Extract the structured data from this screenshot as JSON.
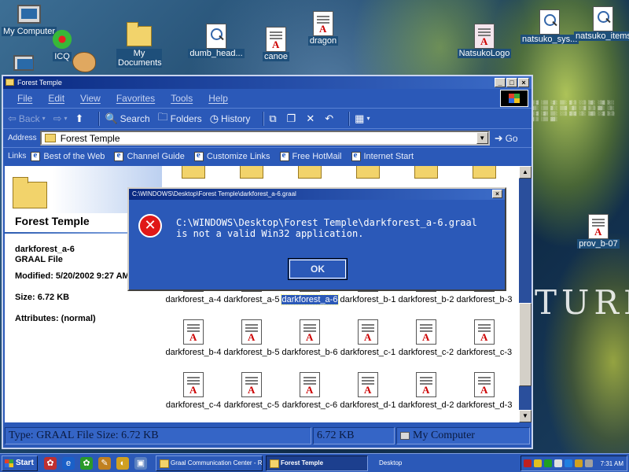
{
  "desktop": {
    "icons": [
      {
        "label": "My Computer"
      },
      {
        "label": "ICQ"
      },
      {
        "label": "My Documents"
      },
      {
        "label": "dumb_head..."
      },
      {
        "label": "canoe"
      },
      {
        "label": "dragon"
      },
      {
        "label": "NatsukoLogo"
      },
      {
        "label": "natsuko_sys..."
      },
      {
        "label": "natsuko_items"
      },
      {
        "label": "prov_b-07"
      }
    ],
    "wallpaper_text": "TURE"
  },
  "window": {
    "title": "Forest Temple",
    "menu": [
      "File",
      "Edit",
      "View",
      "Favorites",
      "Tools",
      "Help"
    ],
    "toolbar": {
      "back": "Back",
      "search": "Search",
      "folders": "Folders",
      "history": "History"
    },
    "address": {
      "label": "Address",
      "value": "Forest Temple",
      "go": "Go"
    },
    "links": {
      "label": "Links",
      "items": [
        "Best of the Web",
        "Channel Guide",
        "Customize Links",
        "Free HotMail",
        "Internet Start"
      ]
    },
    "left_pane": {
      "folder_title": "Forest Temple",
      "file_name": "darkforest_a-6",
      "file_type": "GRAAL File",
      "modified": "Modified: 5/20/2002 9:27 AM",
      "size": "Size: 6.72 KB",
      "attributes": "Attributes: (normal)"
    },
    "files": [
      "darkforest_a-4",
      "darkforest_a-5",
      "darkforest_a-6",
      "darkforest_b-1",
      "darkforest_b-2",
      "darkforest_b-3",
      "darkforest_b-4",
      "darkforest_b-5",
      "darkforest_b-6",
      "darkforest_c-1",
      "darkforest_c-2",
      "darkforest_c-3",
      "darkforest_c-4",
      "darkforest_c-5",
      "darkforest_c-6",
      "darkforest_d-1",
      "darkforest_d-2",
      "darkforest_d-3"
    ],
    "selected_file": "darkforest_a-6",
    "statusbar": {
      "info": "Type: GRAAL File Size: 6.72 KB",
      "size": "6.72 KB",
      "zone": "My Computer"
    }
  },
  "dialog": {
    "title": "C:\\WINDOWS\\Desktop\\Forest Temple\\darkforest_a-6.graal",
    "message": "C:\\WINDOWS\\Desktop\\Forest Temple\\darkforest_a-6.graal is not a valid Win32 application.",
    "ok_label": "OK",
    "icon": "error-icon"
  },
  "taskbar": {
    "start_label": "Start",
    "tasks": [
      {
        "label": "Graal Communication Center - R...",
        "active": false
      },
      {
        "label": "Forest Temple",
        "active": true
      }
    ],
    "desktop_label": "Desktop",
    "clock": "7:31 AM"
  }
}
